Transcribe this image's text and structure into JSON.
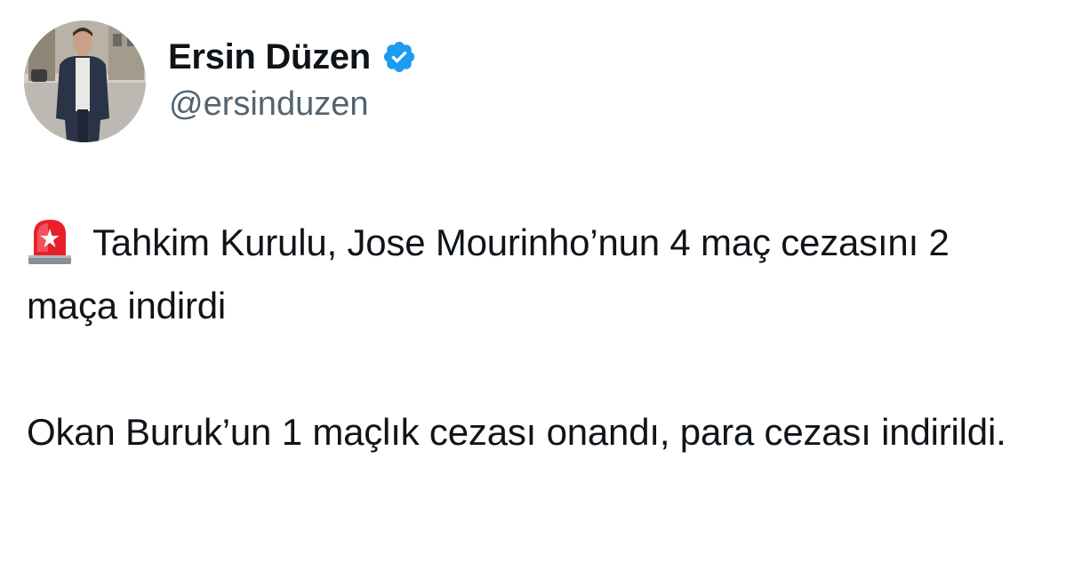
{
  "author": {
    "display_name": "Ersin Düzen",
    "handle": "@ersinduzen",
    "verified_icon": "verified-badge-icon",
    "avatar_icon": "profile-photo"
  },
  "tweet": {
    "emoji_icon": "police-car-light-icon",
    "paragraph_1": "Tahkim Kurulu, Jose Mourinho’nun 4 maç cezasını 2 maça indirdi",
    "paragraph_2": "Okan Buruk’un 1 maçlık cezası onandı, para cezası indirildi."
  },
  "colors": {
    "text": "#0f1419",
    "handle": "#536471",
    "verified": "#1d9bf0",
    "background": "#ffffff"
  }
}
